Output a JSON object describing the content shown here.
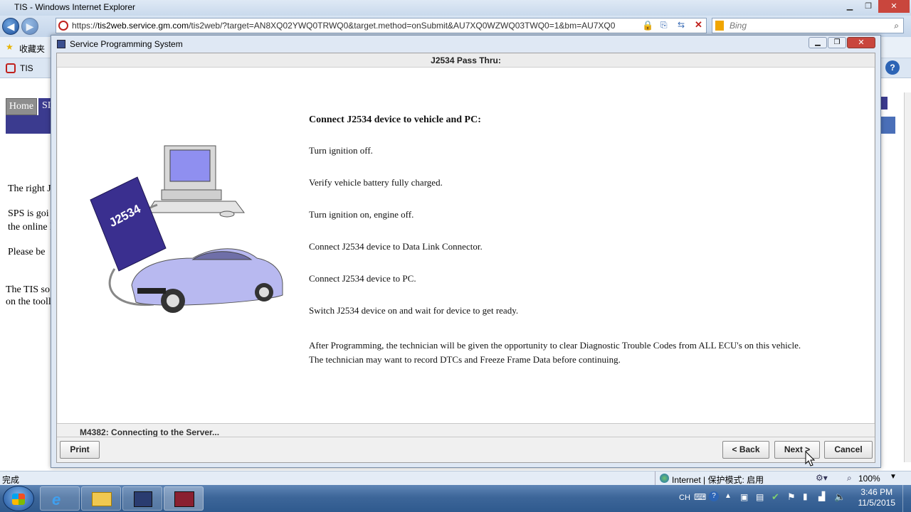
{
  "ie": {
    "window_title": "TIS - Windows Internet Explorer",
    "url_prefix": "https://",
    "url_domain": "tis2web.service.gm.com",
    "url_rest": "/tis2web/?target=AN8XQ02YWQ0TRWQ0&target.method=onSubmit&AU7XQ0WZWQ03TWQ0=1&bm=AU7XQ0",
    "search_placeholder": "Bing",
    "favorites_label": "收藏夹",
    "tab_label": "TIS",
    "status_left": "完成",
    "zone_text": "Internet | 保护模式: 启用",
    "zoom": "100%"
  },
  "bg_page": {
    "tab_home": "Home",
    "tab_partial": "SI",
    "line1": "The right J",
    "line2a": "SPS is goi",
    "line2b": "the online l",
    "line3": "Please be",
    "line4a": "The TIS so",
    "line4b": "on the tooll"
  },
  "dialog": {
    "title": "Service Programming System",
    "header": "J2534 Pass Thru:",
    "heading": "Connect J2534 device to vehicle and PC:",
    "steps": [
      "Turn ignition off.",
      "Verify vehicle battery fully charged.",
      "Turn ignition on, engine off.",
      "Connect J2534 device to Data Link Connector.",
      "Connect J2534 device to PC.",
      "Switch J2534 device on and wait for device to get ready."
    ],
    "note_line1": "After Programming, the technician will be given the opportunity to clear Diagnostic Trouble Codes from ALL ECU's on this vehicle.",
    "note_line2": "The technician may want to record DTCs and Freeze Frame Data before continuing.",
    "device_label": "J2534",
    "status": "M4382: Connecting to the Server...",
    "buttons": {
      "print": "Print",
      "back": "< Back",
      "next": "Next >",
      "cancel": "Cancel"
    }
  },
  "taskbar": {
    "lang": "CH",
    "time": "3:46 PM",
    "date": "11/5/2015"
  },
  "colors": {
    "accent": "#1c4f9a",
    "device": "#3a2f8f",
    "car": "#b8b9f0"
  }
}
